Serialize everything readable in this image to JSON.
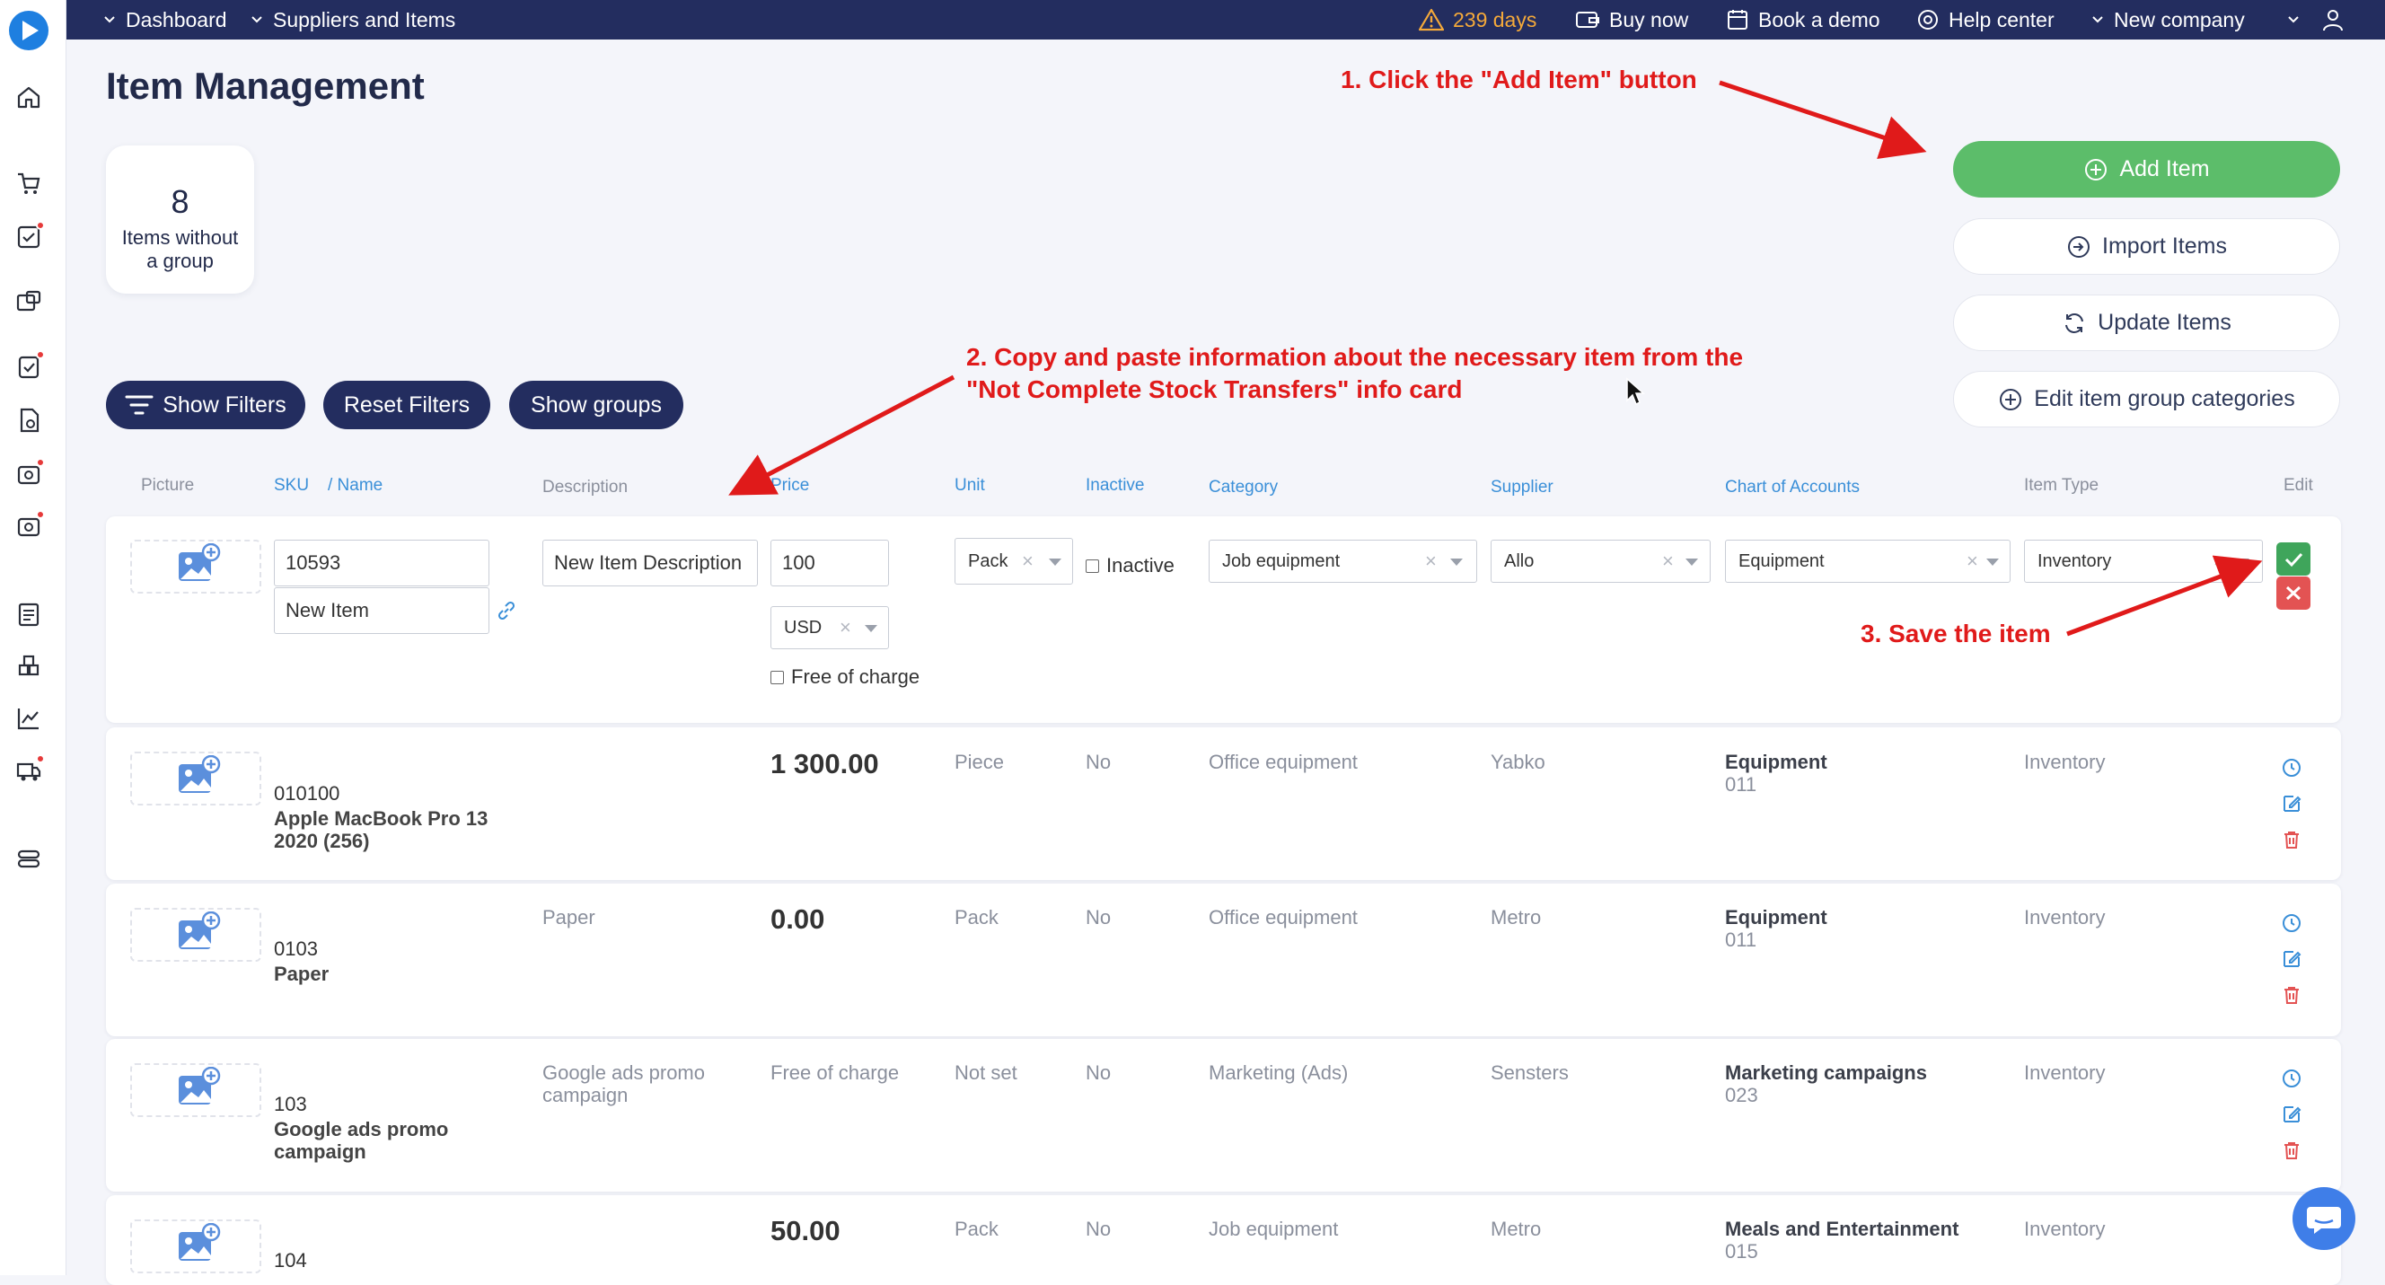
{
  "topbar": {
    "crumb_dashboard": "Dashboard",
    "crumb_suppliers": "Suppliers and Items",
    "warning_days": "239 days",
    "buy_now": "Buy now",
    "book_demo": "Book a demo",
    "help_center": "Help center",
    "company": "New company"
  },
  "page": {
    "title": "Item Management"
  },
  "info_card": {
    "count": "8",
    "label": "Items without a group"
  },
  "actions": {
    "add_item": "Add Item",
    "import_items": "Import Items",
    "update_items": "Update Items",
    "edit_categories": "Edit item group categories"
  },
  "filters": {
    "show_filters": "Show Filters",
    "reset_filters": "Reset Filters",
    "show_groups": "Show groups"
  },
  "annotations": {
    "step1": "1. Click the \"Add Item\" button",
    "step2_line1": "2. Copy and paste information about the necessary item from the",
    "step2_line2": "\"Not Complete Stock Transfers\" info card",
    "step3": "3. Save the item"
  },
  "table": {
    "headers": {
      "picture": "Picture",
      "sku": "SKU",
      "name": "/ Name",
      "description": "Description",
      "price": "Price",
      "unit": "Unit",
      "inactive": "Inactive",
      "category": "Category",
      "supplier": "Supplier",
      "accounts": "Chart of Accounts",
      "item_type": "Item Type",
      "edit": "Edit"
    },
    "new_row": {
      "sku": "10593",
      "name": "New Item",
      "description": "New Item Description",
      "price": "100",
      "currency": "USD",
      "free_label": "Free of charge",
      "unit": "Pack",
      "inactive_label": "Inactive",
      "category": "Job equipment",
      "supplier": "Allo",
      "account": "Equipment",
      "item_type": "Inventory"
    },
    "rows": [
      {
        "sku": "010100",
        "name_line1": "Apple MacBook Pro 13",
        "name_line2": "2020 (256)",
        "description_line1": "",
        "description_line2": "",
        "price": "1 300.00",
        "unit": "Piece",
        "inactive": "No",
        "category": "Office equipment",
        "supplier": "Yabko",
        "account_name": "Equipment",
        "account_code": "011",
        "item_type": "Inventory"
      },
      {
        "sku": "0103",
        "name_line1": "Paper",
        "name_line2": "",
        "description_line1": "Paper",
        "description_line2": "",
        "price": "0.00",
        "unit": "Pack",
        "inactive": "No",
        "category": "Office equipment",
        "supplier": "Metro",
        "account_name": "Equipment",
        "account_code": "011",
        "item_type": "Inventory"
      },
      {
        "sku": "103",
        "name_line1": "Google ads promo",
        "name_line2": "campaign",
        "description_line1": "Google ads promo",
        "description_line2": "campaign",
        "price_text": "Free of charge",
        "unit": "Not set",
        "inactive": "No",
        "category": "Marketing (Ads)",
        "supplier": "Sensters",
        "account_name": "Marketing campaigns",
        "account_code": "023",
        "item_type": "Inventory"
      },
      {
        "sku": "104",
        "name_line1": "",
        "name_line2": "",
        "description_line1": "",
        "description_line2": "",
        "price": "50.00",
        "unit": "Pack",
        "inactive": "No",
        "category": "Job equipment",
        "supplier": "Metro",
        "account_name": "Meals and Entertainment",
        "account_code": "015",
        "item_type": "Inventory"
      }
    ]
  },
  "colors": {
    "topbar": "#232d5f",
    "add_button": "#5cbd6a",
    "link_blue": "#3a8fd8",
    "annotation_red": "#e01a1a"
  }
}
